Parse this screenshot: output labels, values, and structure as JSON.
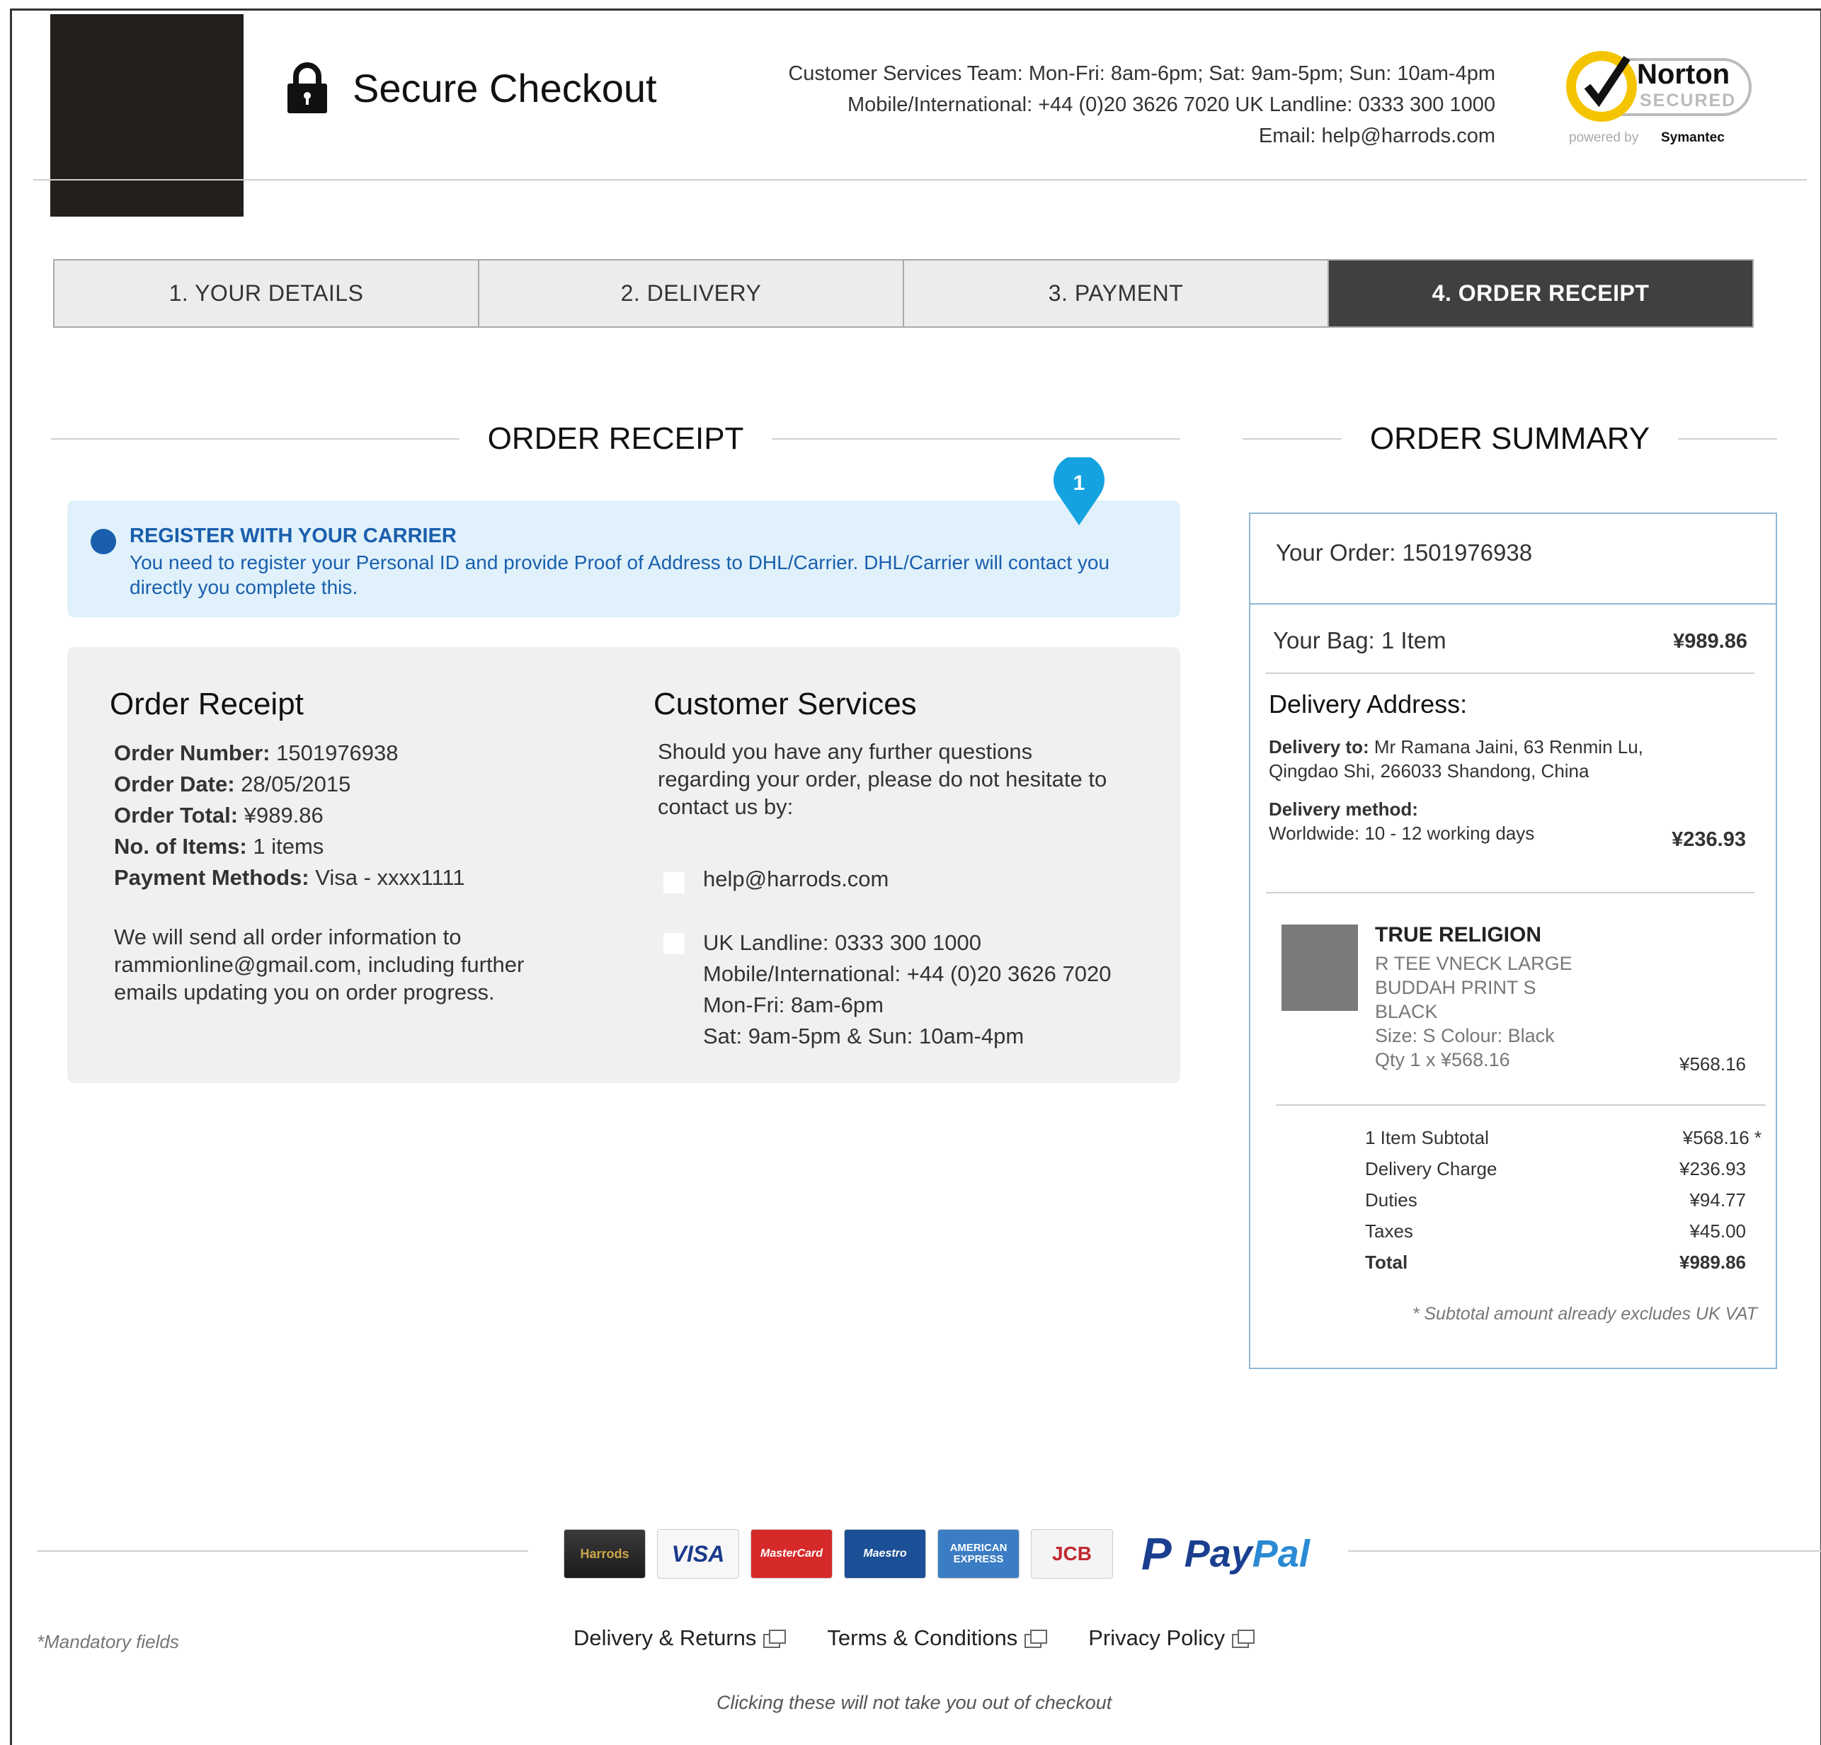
{
  "header": {
    "title": "Secure Checkout",
    "contact_lines": [
      "Customer Services Team: Mon-Fri: 8am-6pm; Sat: 9am-5pm; Sun: 10am-4pm",
      "Mobile/International: +44 (0)20 3626 7020 UK Landline: 0333 300 1000",
      "Email: help@harrods.com"
    ],
    "norton": {
      "brand": "Norton",
      "secured": "SECURED",
      "powered_by": "powered by",
      "vendor": "Symantec"
    }
  },
  "steps": [
    {
      "label": "1. YOUR DETAILS",
      "active": false
    },
    {
      "label": "2. DELIVERY",
      "active": false
    },
    {
      "label": "3. PAYMENT",
      "active": false
    },
    {
      "label": "4. ORDER RECEIPT",
      "active": true
    }
  ],
  "receipt_section": {
    "heading": "ORDER RECEIPT",
    "pin_number": "1",
    "alert": {
      "title": "REGISTER WITH YOUR CARRIER",
      "text": "You need to register your Personal ID and provide Proof of Address to DHL/Carrier. DHL/Carrier will contact you directly you complete this."
    },
    "panel": {
      "receipt_title": "Order Receipt",
      "lines": [
        {
          "label": "Order Number:",
          "value": "1501976938"
        },
        {
          "label": "Order Date:",
          "value": "28/05/2015"
        },
        {
          "label": "Order Total:",
          "value": "¥989.86"
        },
        {
          "label": "No. of Items:",
          "value": "1 items"
        },
        {
          "label": "Payment Methods:",
          "value": "Visa - xxxx1111"
        }
      ],
      "note": "We will send all order information to rammionline@gmail.com, including further emails updating you on order progress.",
      "services_title": "Customer Services",
      "services_intro": "Should you have any further questions regarding your order, please do not hesitate to contact us by:",
      "email": "help@harrods.com",
      "phone_lines": [
        "UK Landline: 0333 300 1000",
        "Mobile/International: +44 (0)20 3626 7020",
        "Mon-Fri: 8am-6pm",
        "Sat: 9am-5pm & Sun: 10am-4pm"
      ]
    }
  },
  "summary": {
    "heading": "ORDER SUMMARY",
    "your_order": "Your Order: 1501976938",
    "bag_label": "Your Bag: 1 Item",
    "bag_total": "¥989.86",
    "address_title": "Delivery Address:",
    "delivery_to_label": "Delivery to:",
    "delivery_to_value": "Mr Ramana Jaini, 63 Renmin Lu, Qingdao Shi, 266033 Shandong, China",
    "method_label": "Delivery method:",
    "method_value": "Worldwide: 10 - 12 working days",
    "method_price": "¥236.93",
    "product": {
      "brand": "TRUE RELIGION",
      "name_lines": [
        "R TEE VNECK LARGE",
        "BUDDAH PRINT S",
        "BLACK"
      ],
      "size_colour": "Size: S  Colour: Black",
      "qty": "Qty 1 x ¥568.16",
      "price": "¥568.16"
    },
    "totals": [
      {
        "label": "1 Item Subtotal",
        "value": "¥568.16 *",
        "bold": false
      },
      {
        "label": "Delivery Charge",
        "value": "¥236.93",
        "bold": false
      },
      {
        "label": "Duties",
        "value": "¥94.77",
        "bold": false
      },
      {
        "label": "Taxes",
        "value": "¥45.00",
        "bold": false
      },
      {
        "label": "Total",
        "value": "¥989.86",
        "bold": true
      }
    ],
    "vat_note": "* Subtotal amount already excludes UK VAT"
  },
  "footer": {
    "cards": [
      "Harrods",
      "VISA",
      "MasterCard",
      "Maestro",
      "AMERICAN EXPRESS",
      "JCB"
    ],
    "paypal_pay": "Pay",
    "paypal_pal": "Pal",
    "mandatory": "*Mandatory fields",
    "links": [
      "Delivery & Returns",
      "Terms & Conditions",
      "Privacy Policy"
    ],
    "note": "Clicking these will not take you out of checkout"
  },
  "colors": {
    "accent_blue": "#1a5fad",
    "alert_bg": "#e0f1fb",
    "active_step": "#404040",
    "pin": "#14a3e0"
  }
}
